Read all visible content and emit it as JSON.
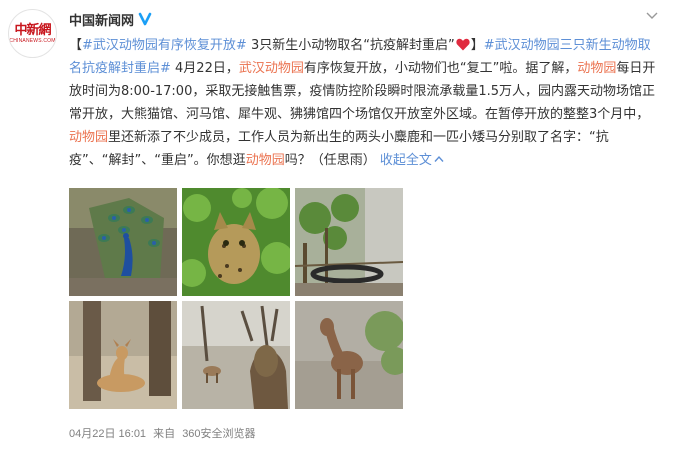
{
  "account": {
    "name": "中国新闻网",
    "avatar_logo_text": "中新網",
    "avatar_logo_sub": "CHINANEWS.COM"
  },
  "post": {
    "bracket_open": "【",
    "topic1": "#武汉动物园有序恢复开放#",
    "headline": " 3只新生小动物取名“抗疫解封重启”",
    "bracket_close": "】",
    "topic2": "#武汉动物园三只新生动物取名抗疫解封重启#",
    "seg1": " 4月22日，",
    "link1": "武汉动物园",
    "seg2": "有序恢复开放，小动物们也“复工”啦。据了解，",
    "link2": "动物园",
    "seg3": "每日开放时间为8:00-17:00，采取无接触售票，疫情防控阶段瞬时限流承载量1.5万人，园内露天动物场馆正常开放，大熊猫馆、河马馆、犀牛观、狒狒馆四个场馆仅开放室外区域。在暂停开放的整整3个月中，",
    "link3": "动物园",
    "seg4": "里还新添了不少成员，工作人员为新出生的两头小麋鹿和一匹小矮马分别取了名字：“抗疫”、“解封”、“重启”。你想逛",
    "link4": "动物园",
    "seg5": "吗？（任思雨） ",
    "collapse_label": "收起全文",
    "collapse_icon": "chevron-up-icon"
  },
  "photos": [
    {
      "subject": "peacock"
    },
    {
      "subject": "serval-cat"
    },
    {
      "subject": "enclosure"
    },
    {
      "subject": "fawn"
    },
    {
      "subject": "deer"
    },
    {
      "subject": "pony"
    }
  ],
  "footer": {
    "date": "04月22日 16:01",
    "source_prefix": "来自",
    "source": "360安全浏览器"
  },
  "colors": {
    "link_orange": "#eb7350",
    "topic_blue": "#5d8fd6",
    "verified_blue": "#1b9ff6",
    "heart_red": "#e02b3f"
  }
}
